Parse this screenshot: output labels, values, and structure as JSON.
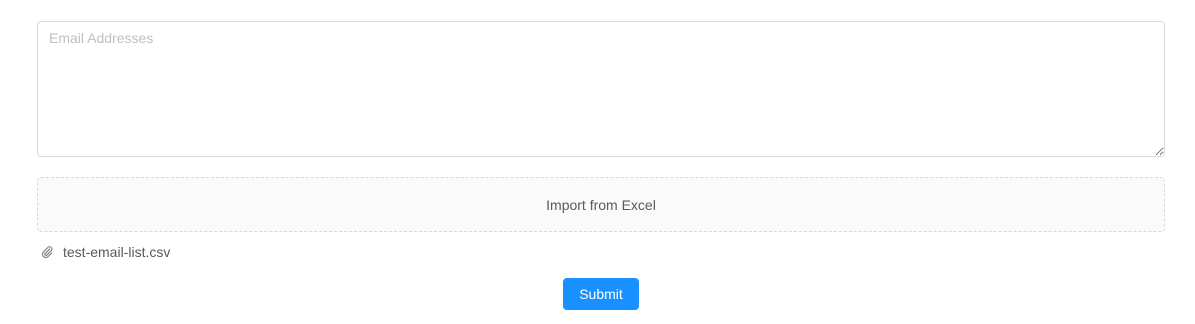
{
  "email_field": {
    "value": "",
    "placeholder": "Email Addresses"
  },
  "upload": {
    "label": "Import from Excel"
  },
  "attachment": {
    "icon": "paperclip-icon",
    "file_name": "test-email-list.csv"
  },
  "form": {
    "submit_label": "Submit"
  },
  "colors": {
    "primary": "#1890ff",
    "border": "#d9d9d9",
    "placeholder": "#bfbfbf",
    "text": "#595959",
    "dragger_bg": "#fafafa"
  }
}
